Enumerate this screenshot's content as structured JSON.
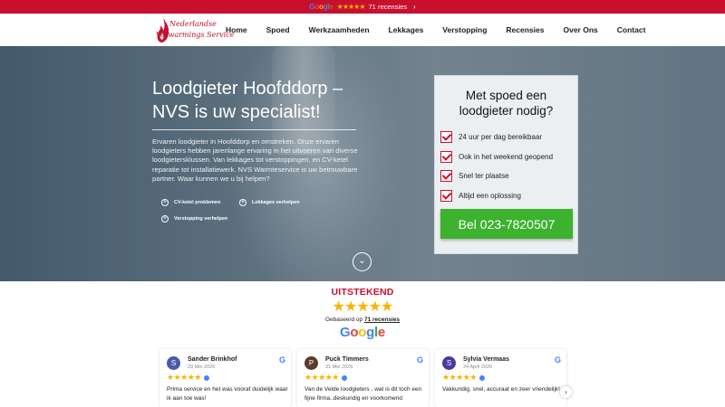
{
  "topbar": {
    "google_text": "Google",
    "stars": "★★★★★",
    "reviews_count": "71 recensies",
    "chevron": "›"
  },
  "logo": {
    "line1": "Nederlandse",
    "line2": "Verwarmings Service"
  },
  "nav": {
    "items": [
      "Home",
      "Spoed",
      "Werkzaamheden",
      "Lekkages",
      "Verstopping",
      "Recensies",
      "Over Ons",
      "Contact"
    ]
  },
  "hero": {
    "title": "Loodgieter Hoofddorp – NVS is uw specialist!",
    "intro": "Ervaren loodgieter in Hoofddorp en omstreken. Onze ervaren loodgieters hebben jarenlange ervaring in het uitvoeren van diverse loodgietersklussen. Van lekkages tot verstoppingen, en CV-ketel reparatie tot installatiewerk. NVS Warmteservice is uw betrouwbare partner. Waar kunnen we u bij helpen?",
    "features": [
      "CV-ketel problemen",
      "Lekkages verhelpen",
      "Verstopping verhelpen"
    ],
    "scroll_icon": "⌄"
  },
  "card": {
    "title": "Met spoed een loodgieter nodig?",
    "checks": [
      "24 uur per dag bereikbaar",
      "Ook in het weekend geopend",
      "Snel ter plaatse",
      "Altijd een oplossing"
    ],
    "call_button": "Bel 023-7820507"
  },
  "reviews": {
    "rating_label": "UITSTEKEND",
    "stars": "★★★★★",
    "based_prefix": "Gebaseerd op",
    "based_count": "71 recensies",
    "google_letters": [
      "G",
      "o",
      "o",
      "g",
      "l",
      "e"
    ],
    "items": [
      {
        "initial": "S",
        "name": "Sander Brinkhof",
        "date": "29 Mei 2026",
        "stars": "★★★★★",
        "text": "Prima service en het was vooraf duidelijk waar ik aan toe was!",
        "avatar_color": "#4a5ba8"
      },
      {
        "initial": "P",
        "name": "Puck Timmers",
        "date": "31 Mei 2026",
        "stars": "★★★★★",
        "text": "Van de Velde loodgieters , wat is dit toch een fijne firma..deskundig en voorkomend",
        "avatar_color": "#5d3b2c"
      },
      {
        "initial": "S",
        "name": "Sylvia Vermaas",
        "date": "24 April 2026",
        "stars": "★★★★★",
        "text": "Vakkundig, snel, accuraat en zeer vriendelijk!",
        "avatar_color": "#4b3aa0"
      }
    ],
    "next_arrow": "›"
  },
  "colors": {
    "brand_red": "#c8102e",
    "call_green": "#3cb22e",
    "star_gold": "#f7b500"
  }
}
